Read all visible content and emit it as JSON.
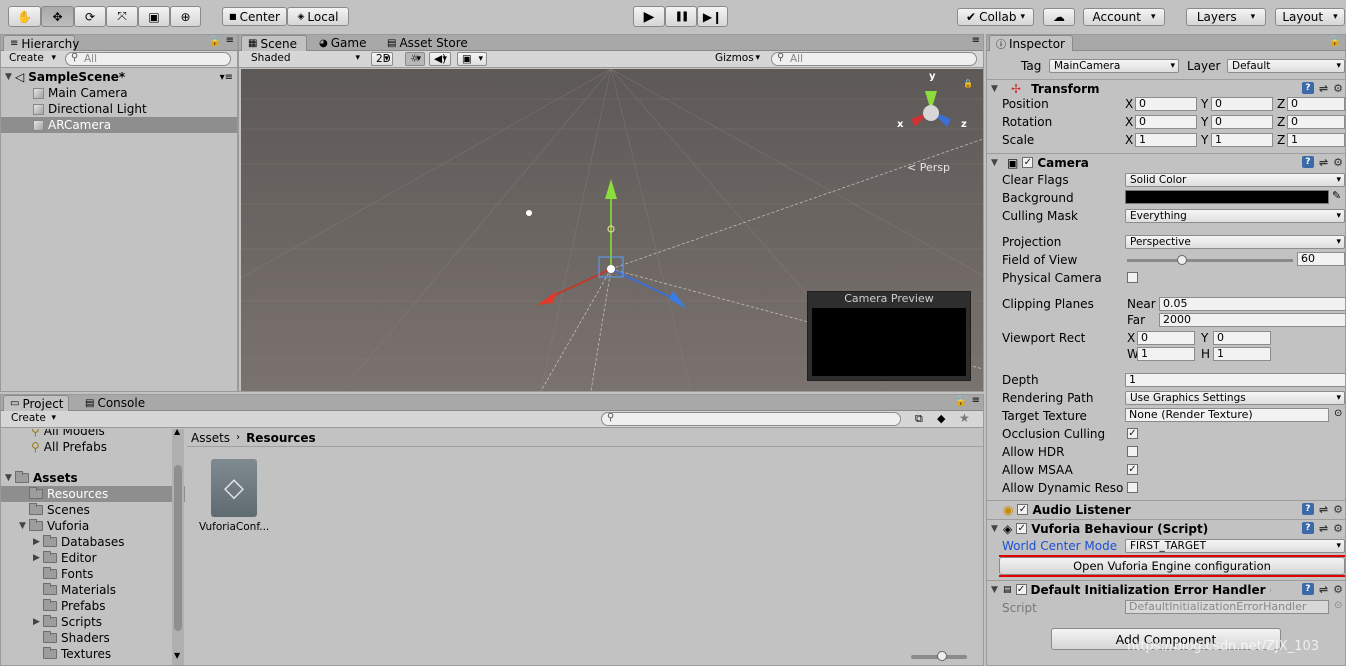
{
  "toolbar": {
    "tools": [
      "hand-icon",
      "move-icon",
      "rotate-icon",
      "scale-icon",
      "rect-icon",
      "transform-icon"
    ],
    "pivot": "Center",
    "space": "Local",
    "play": "▶",
    "pause": "❚❚",
    "step": "▶❙",
    "collab": "Collab",
    "account": "Account",
    "layers": "Layers",
    "layout": "Layout"
  },
  "hierarchy": {
    "tab": "Hierarchy",
    "create": "Create",
    "search_placeholder": "All",
    "scene": "SampleScene*",
    "items": [
      "Main Camera",
      "Directional Light",
      "ARCamera"
    ],
    "selected": 2
  },
  "scene": {
    "tabs": [
      "Scene",
      "Game",
      "Asset Store"
    ],
    "shading": "Shaded",
    "mode2d": "2D",
    "gizmos": "Gizmos",
    "search_placeholder": "All",
    "persp": "< Persp",
    "gizmo_axes": {
      "x": "x",
      "y": "y",
      "z": "z"
    },
    "preview_title": "Camera Preview"
  },
  "project": {
    "tabs": [
      "Project",
      "Console"
    ],
    "create": "Create",
    "favorites": [
      "All Models",
      "All Prefabs"
    ],
    "root": "Assets",
    "tree": [
      {
        "label": "Resources",
        "depth": 1,
        "arrow": "",
        "selected": true
      },
      {
        "label": "Scenes",
        "depth": 1,
        "arrow": ""
      },
      {
        "label": "Vuforia",
        "depth": 1,
        "arrow": "▼"
      },
      {
        "label": "Databases",
        "depth": 2,
        "arrow": "▶"
      },
      {
        "label": "Editor",
        "depth": 2,
        "arrow": "▶"
      },
      {
        "label": "Fonts",
        "depth": 2,
        "arrow": ""
      },
      {
        "label": "Materials",
        "depth": 2,
        "arrow": ""
      },
      {
        "label": "Prefabs",
        "depth": 2,
        "arrow": ""
      },
      {
        "label": "Scripts",
        "depth": 2,
        "arrow": "▶"
      },
      {
        "label": "Shaders",
        "depth": 2,
        "arrow": ""
      },
      {
        "label": "Textures",
        "depth": 2,
        "arrow": ""
      }
    ],
    "breadcrumb": [
      "Assets",
      "Resources"
    ],
    "asset_name": "VuforiaConf..."
  },
  "inspector": {
    "tab": "Inspector",
    "tag_label": "Tag",
    "tag": "MainCamera",
    "layer_label": "Layer",
    "layer": "Default",
    "transform": {
      "title": "Transform",
      "rows": [
        {
          "label": "Position",
          "x": "0",
          "y": "0",
          "z": "0"
        },
        {
          "label": "Rotation",
          "x": "0",
          "y": "0",
          "z": "0"
        },
        {
          "label": "Scale",
          "x": "1",
          "y": "1",
          "z": "1"
        }
      ]
    },
    "camera": {
      "title": "Camera",
      "clear_flags_label": "Clear Flags",
      "clear_flags": "Solid Color",
      "background_label": "Background",
      "background_color": "#000000",
      "culling_mask_label": "Culling Mask",
      "culling_mask": "Everything",
      "projection_label": "Projection",
      "projection": "Perspective",
      "fov_label": "Field of View",
      "fov": "60",
      "fov_fraction": 0.33,
      "physical_label": "Physical Camera",
      "clipping_label": "Clipping Planes",
      "near_label": "Near",
      "near": "0.05",
      "far_label": "Far",
      "far": "2000",
      "viewport_label": "Viewport Rect",
      "vx": "0",
      "vy": "0",
      "vw": "1",
      "vh": "1",
      "depth_label": "Depth",
      "depth": "1",
      "rendering_label": "Rendering Path",
      "rendering": "Use Graphics Settings",
      "target_label": "Target Texture",
      "target": "None (Render Texture)",
      "occlusion_label": "Occlusion Culling",
      "hdr_label": "Allow HDR",
      "msaa_label": "Allow MSAA",
      "dynres_label": "Allow Dynamic Resolu"
    },
    "audio_listener": "Audio Listener",
    "vuforia": {
      "title": "Vuforia Behaviour (Script)",
      "world_center_label": "World Center Mode",
      "world_center": "FIRST_TARGET",
      "open_button": "Open Vuforia Engine configuration"
    },
    "error_handler": {
      "title": "Default Initialization Error Handler (",
      "script_label": "Script",
      "script": "DefaultInitializationErrorHandler"
    },
    "add_component": "Add Component",
    "watermark": "https://blog.csdn.net/ZJX_103"
  }
}
